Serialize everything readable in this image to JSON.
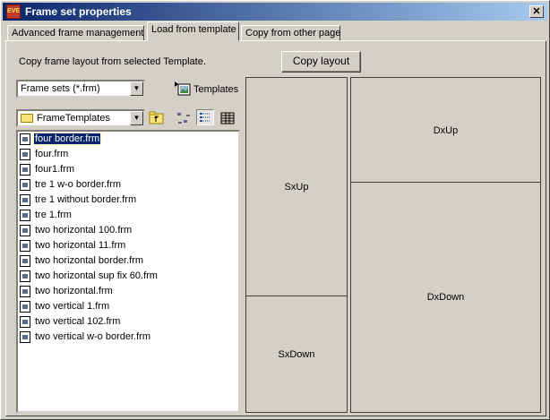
{
  "window": {
    "title": "Frame set properties",
    "close_glyph": "✕",
    "app_icon_text": "EVE"
  },
  "tabs": [
    {
      "label": "Advanced frame management"
    },
    {
      "label": "Load from template"
    },
    {
      "label": "Copy from other page"
    }
  ],
  "load": {
    "instruction": "Copy frame layout from selected Template.",
    "copy_button": "Copy layout",
    "filter_combo": "Frame sets (*.frm)",
    "templates_label": "Templates",
    "folder_combo": "FrameTemplates",
    "combo_arrow": "▼",
    "files": [
      "four border.frm",
      "four.frm",
      "four1.frm",
      "tre 1 w-o border.frm",
      "tre 1 without border.frm",
      "tre 1.frm",
      "two horizontal 100.frm",
      "two horizontal 11.frm",
      "two horizontal border.frm",
      "two horizontal sup fix 60.frm",
      "two horizontal.frm",
      "two vertical 1.frm",
      "two vertical 102.frm",
      "two vertical w-o border.frm"
    ],
    "selected_file_index": 0
  },
  "preview": {
    "frames": {
      "sx_up": "SxUp",
      "sx_down": "SxDown",
      "dx_up": "DxUp",
      "dx_down": "DxDown"
    }
  }
}
